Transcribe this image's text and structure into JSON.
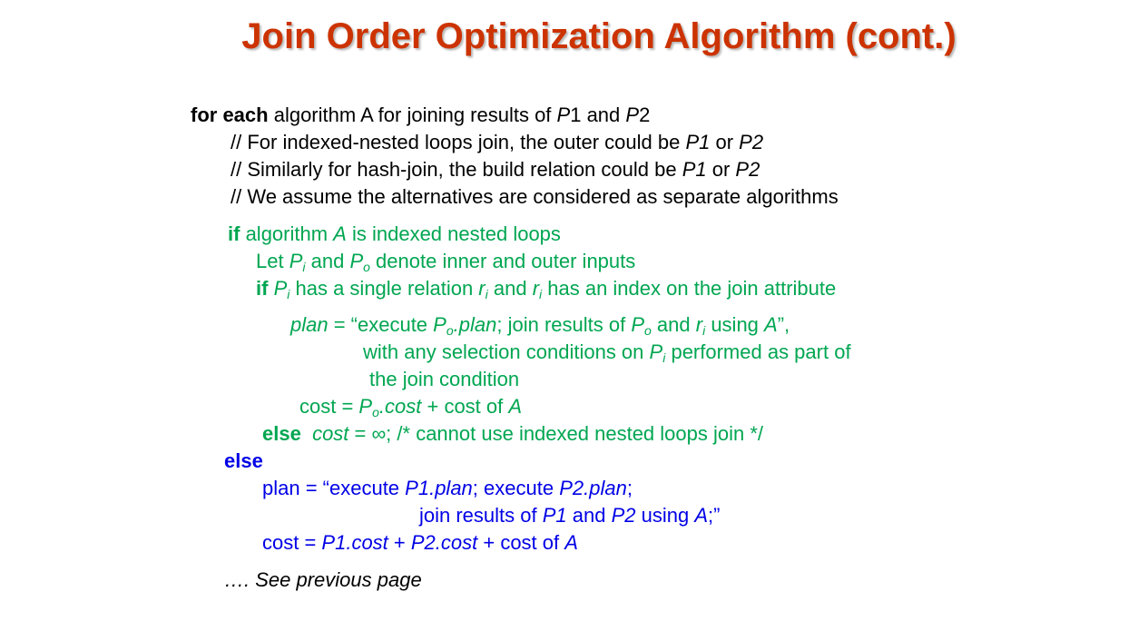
{
  "slide": {
    "title": "Join Order Optimization Algorithm (cont.)"
  },
  "code": {
    "l1": {
      "kw": "for each",
      "t1": " algorithm A for joining results of ",
      "v1": "P",
      "t2": "1 and ",
      "v2": "P",
      "t3": "2"
    },
    "l2": {
      "t1": "// For indexed-nested loops join, the outer could be ",
      "v1": "P1",
      "t2": " or ",
      "v2": "P2"
    },
    "l3": {
      "t1": "// Similarly for hash-join, the build relation could be ",
      "v1": "P1",
      "t2": " or ",
      "v2": "P2"
    },
    "l4": {
      "t1": "//  We assume the alternatives are considered as separate algorithms"
    },
    "l5": {
      "kw": "if",
      "t1": " algorithm ",
      "v1": "A",
      "t2": " is indexed nested loops"
    },
    "l6": {
      "t1": "Let ",
      "v1": "P",
      "s1": "i",
      "t2": " and ",
      "v2": "P",
      "s2": "o",
      "t3": " denote inner and outer inputs"
    },
    "l7": {
      "kw": "if",
      "t0": " ",
      "v1": "P",
      "s1": "i",
      "t1": " has a single relation ",
      "v2": "r",
      "s2": "i",
      "t2": " and ",
      "v3": "r",
      "s3": "i",
      "t3": " has an index on the join attribute"
    },
    "l8": {
      "v1": "plan",
      "t1": " = “execute ",
      "v2": "P",
      "s2": "o",
      "v3": ".plan",
      "t2": "; join results of ",
      "v4": "P",
      "s4": "o",
      "t3": " and ",
      "v5": "r",
      "s5": "i",
      "t4": " using ",
      "v6": "A",
      "t5": "”,"
    },
    "l9": {
      "t1": "with any selection conditions on ",
      "v1": "P",
      "s1": "i",
      "t2": " performed as part of"
    },
    "l10": {
      "t1": "the join condition"
    },
    "l11": {
      "t1": "cost = ",
      "v1": "P",
      "s1": "o",
      "v2": ".cost",
      "t2": " + cost of ",
      "v3": "A"
    },
    "l12": {
      "kw": "else",
      "t0": "  ",
      "v1": "cost",
      "t1": " = ∞; /* cannot use indexed nested loops join */"
    },
    "l13": {
      "kw": "else"
    },
    "l14": {
      "t1": "plan = “execute ",
      "v1": "P1.plan",
      "t2": "; execute ",
      "v2": "P2.plan",
      "t3": ";"
    },
    "l15": {
      "t1": "join results of ",
      "v1": "P1",
      "t2": " and ",
      "v2": "P2",
      "t3": " using ",
      "v3": "A",
      "t4": ";”"
    },
    "l16": {
      "t1": "cost = ",
      "v1": "P1.cost",
      "t2": " + ",
      "v2": "P2.cost",
      "t3": " + cost of ",
      "v3": "A"
    },
    "l17": {
      "t1": "…. See previous page"
    }
  }
}
